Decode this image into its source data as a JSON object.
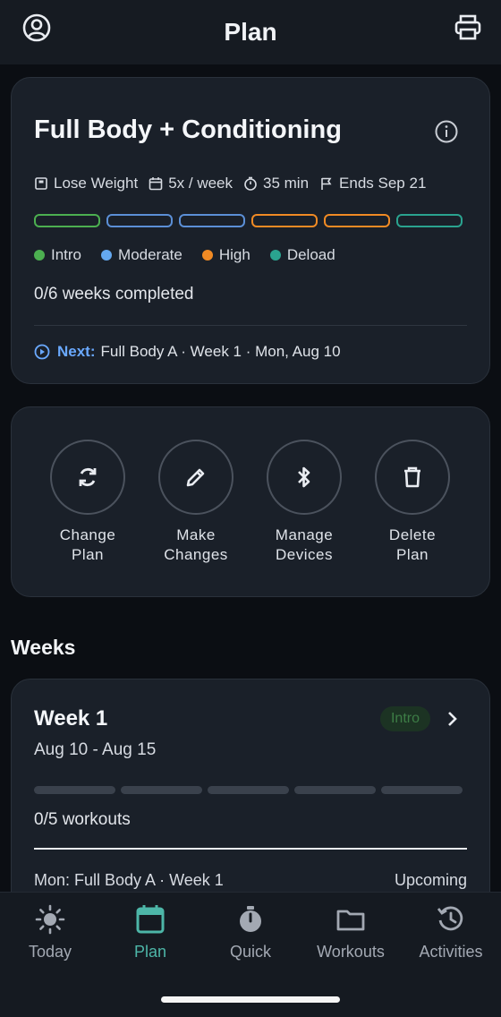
{
  "header": {
    "title": "Plan",
    "left_icon": "profile-icon",
    "right_icon": "print-icon"
  },
  "plan": {
    "title": "Full Body + Conditioning",
    "meta": [
      {
        "icon": "goal-icon",
        "label": "Lose Weight"
      },
      {
        "icon": "calendar-icon",
        "label": "5x / week"
      },
      {
        "icon": "stopwatch-icon",
        "label": "35 min"
      },
      {
        "icon": "flag-icon",
        "label": "Ends Sep 21"
      }
    ],
    "phases": [
      "#4caf50",
      "#5b8fd6",
      "#5b8fd6",
      "#f08a24",
      "#f08a24",
      "#2aa38f"
    ],
    "legend": [
      {
        "label": "Intro",
        "color": "#4caf50"
      },
      {
        "label": "Moderate",
        "color": "#64a8f0"
      },
      {
        "label": "High",
        "color": "#f08a24"
      },
      {
        "label": "Deload",
        "color": "#2aa38f"
      }
    ],
    "weeks_completed": "0/6 weeks completed",
    "next_label": "Next:",
    "next_value": "Full Body A · Week 1 · Mon, Aug 10"
  },
  "actions": [
    {
      "line1": "Change",
      "line2": "Plan",
      "icon": "refresh-icon"
    },
    {
      "line1": "Make",
      "line2": "Changes",
      "icon": "pencil-icon"
    },
    {
      "line1": "Manage",
      "line2": "Devices",
      "icon": "bluetooth-icon"
    },
    {
      "line1": "Delete",
      "line2": "Plan",
      "icon": "trash-icon"
    }
  ],
  "weeks_section": "Weeks",
  "week1": {
    "title": "Week 1",
    "badge": "Intro",
    "dates": "Aug 10 - Aug 15",
    "workouts": "0/5 workouts",
    "workouts_done": 0,
    "workouts_total": 5,
    "first_row_label": "Mon: Full Body A · Week 1",
    "first_row_status": "Upcoming"
  },
  "nav": [
    {
      "label": "Today",
      "icon": "sun-icon"
    },
    {
      "label": "Plan",
      "icon": "calendar-icon",
      "active": true
    },
    {
      "label": "Quick",
      "icon": "stopwatch-icon"
    },
    {
      "label": "Workouts",
      "icon": "folder-icon"
    },
    {
      "label": "Activities",
      "icon": "history-icon"
    }
  ],
  "colors": {
    "accent": "#4db6a8",
    "next": "#6aa9ff",
    "badge_text": "#3d7d46"
  }
}
